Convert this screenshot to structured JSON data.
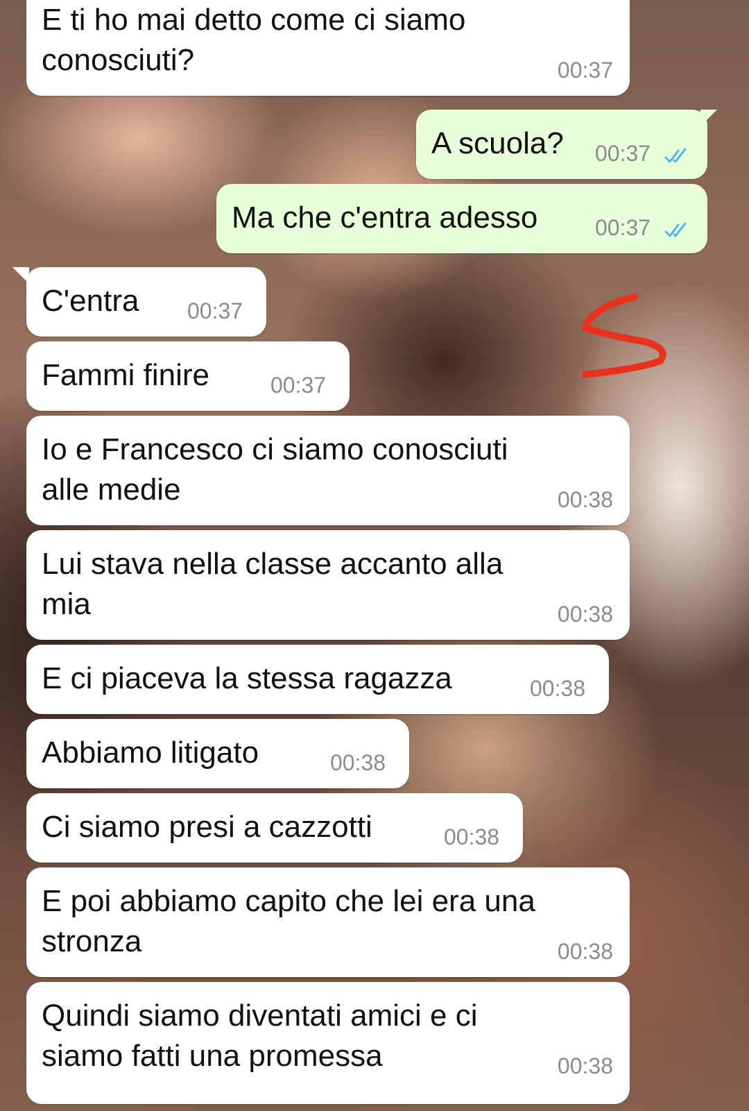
{
  "colors": {
    "incoming_bubble": "#ffffff",
    "outgoing_bubble": "#e7ffdb",
    "timestamp": "#8b8b8b",
    "read_ticks": "#4fb6ec",
    "scribble": "#e8321e"
  },
  "messages": [
    {
      "text": "E ti ho mai detto come ci siamo\nconosciuti?",
      "time": "00:37"
    },
    {
      "text": "A scuola?",
      "time": "00:37",
      "status": "read",
      "status_icon": "double-check-icon"
    },
    {
      "text": "Ma che c'entra adesso",
      "time": "00:37",
      "status": "read",
      "status_icon": "double-check-icon"
    },
    {
      "text": "C'entra",
      "time": "00:37"
    },
    {
      "text": "Fammi finire",
      "time": "00:37"
    },
    {
      "text": "Io e Francesco ci siamo conosciuti\nalle medie",
      "time": "00:38"
    },
    {
      "text": "Lui stava nella classe accanto alla\nmia",
      "time": "00:38"
    },
    {
      "text": "E ci piaceva la stessa ragazza",
      "time": "00:38"
    },
    {
      "text": "Abbiamo litigato",
      "time": "00:38"
    },
    {
      "text": "Ci siamo presi a cazzotti",
      "time": "00:38"
    },
    {
      "text": "E poi abbiamo capito che lei era una\nstronza",
      "time": "00:38"
    },
    {
      "text": "Quindi siamo diventati amici e ci\nsiamo fatti una promessa",
      "time": "00:38"
    }
  ]
}
